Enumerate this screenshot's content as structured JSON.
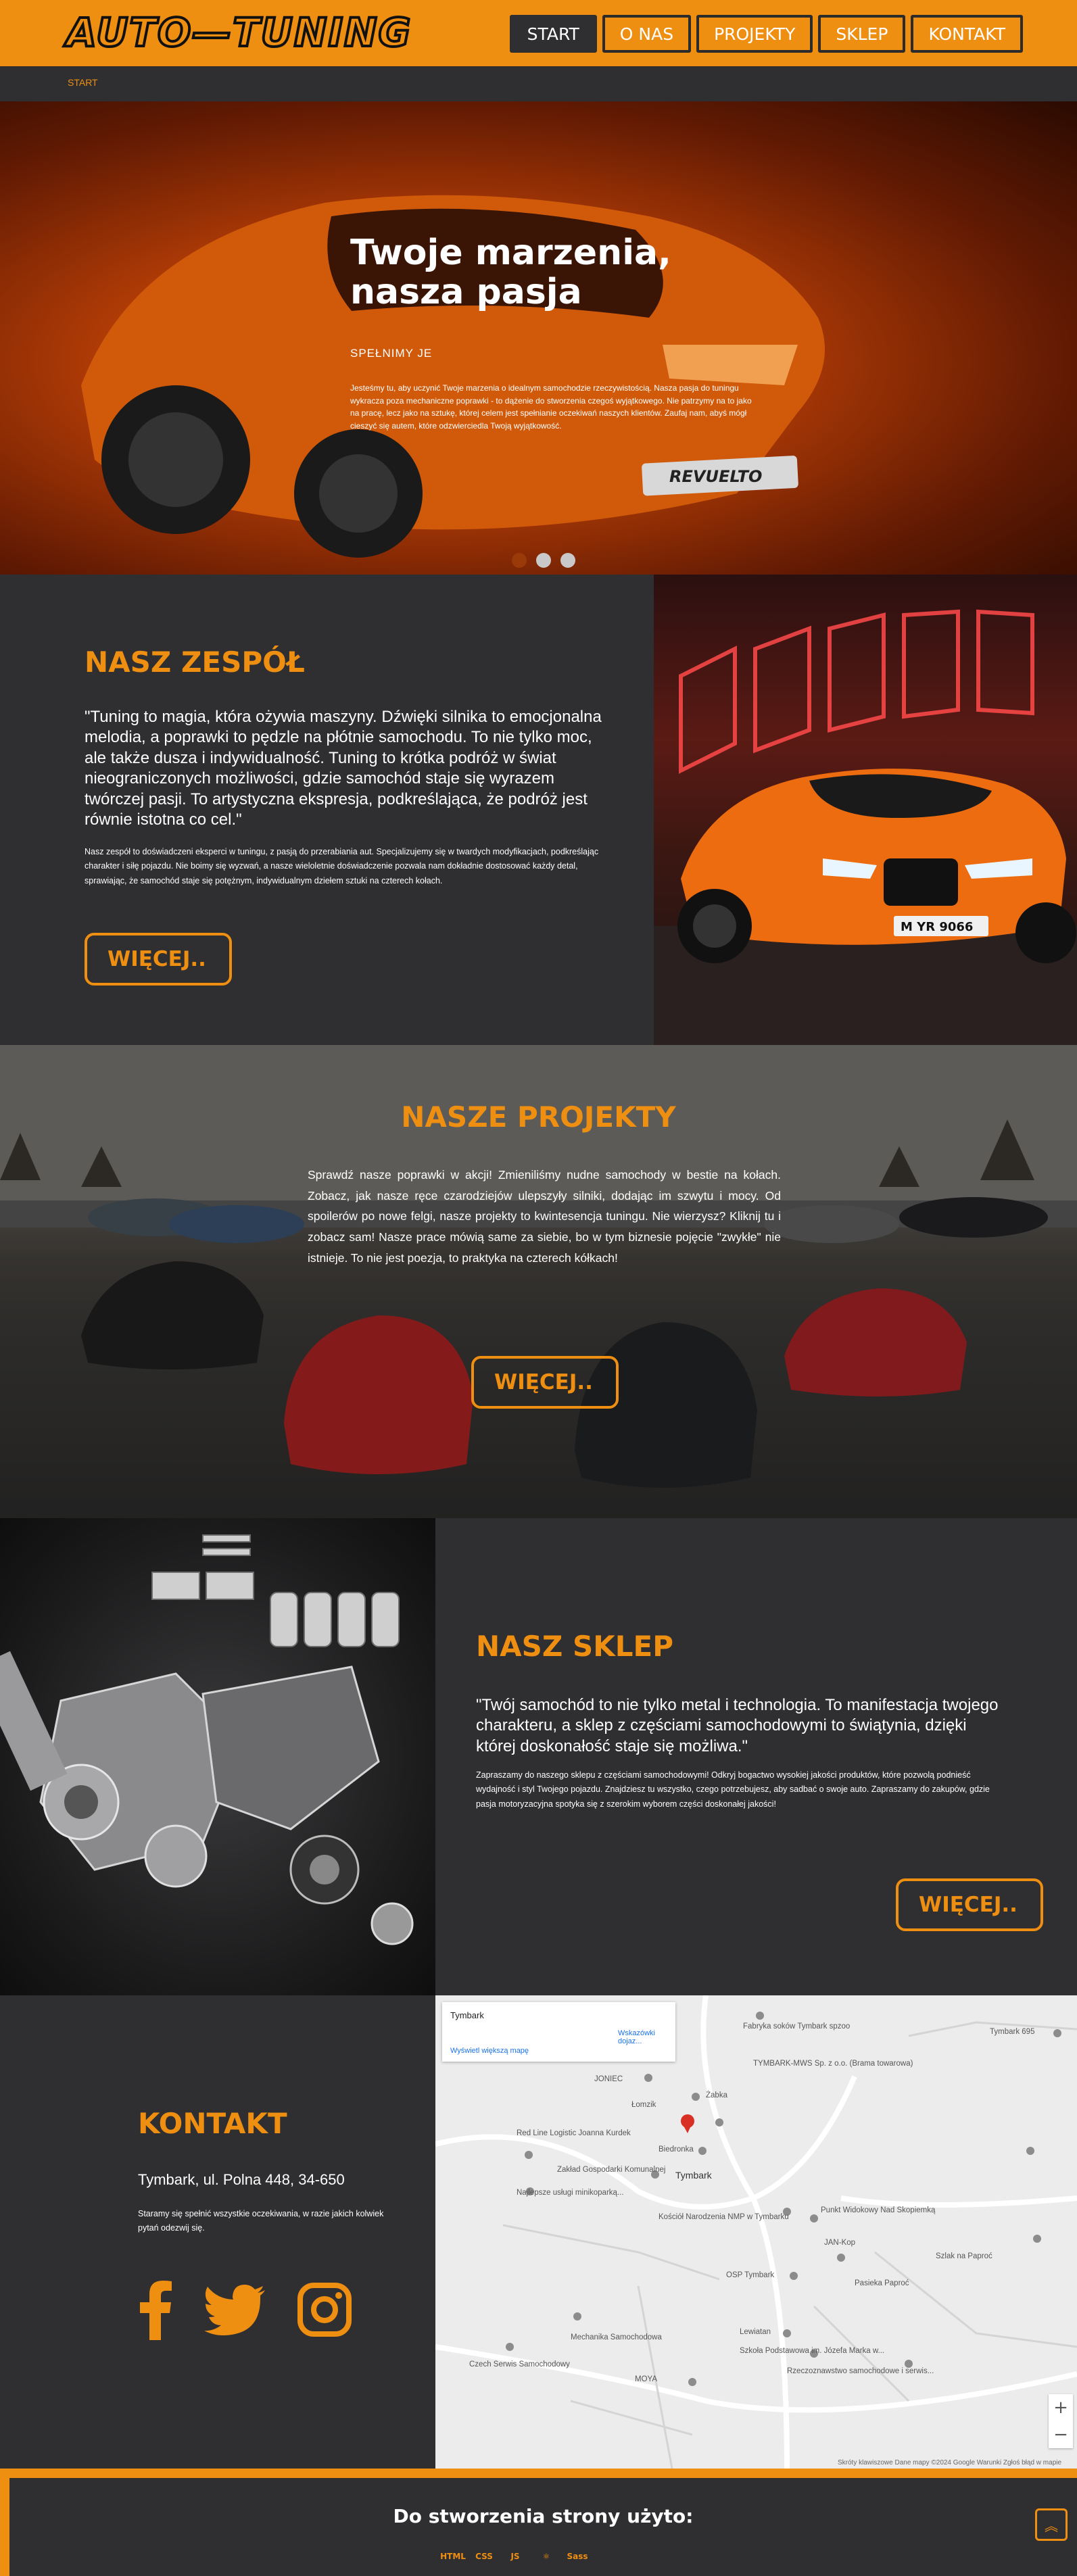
{
  "brand": {
    "logo_text": "AUTO—TUNING",
    "accent": "#ef8f12",
    "dark": "#2f2f31"
  },
  "nav": {
    "items": [
      {
        "label": "START",
        "active": true
      },
      {
        "label": "O NAS"
      },
      {
        "label": "PROJEKTY"
      },
      {
        "label": "SKLEP"
      },
      {
        "label": "KONTAKT"
      }
    ]
  },
  "breadcrumb": "START",
  "hero": {
    "title_line1": "Twoje marzenia,",
    "title_line2": "nasza pasja",
    "subtitle": "SPEŁNIMY JE",
    "text": "Jesteśmy tu, aby uczynić Twoje marzenia o idealnym samochodzie rzeczywistością. Nasza pasja do tuningu wykracza poza mechaniczne poprawki - to dążenie do stworzenia czegoś wyjątkowego. Nie patrzymy na to jako na pracę, lecz jako na sztukę, której celem jest spełnianie oczekiwań naszych klientów. Zaufaj nam, abyś mógł cieszyć się autem, które odzwierciedla Twoją wyjątkowość.",
    "plate": "REVUELTO",
    "slides": 3,
    "active_slide": 0
  },
  "team": {
    "title": "NASZ ZESPÓŁ",
    "quote": "\"Tuning to magia, która ożywia maszyny. Dźwięki silnika to emocjonalna melodia, a poprawki to pędzle na płótnie samochodu. To nie tylko moc, ale także dusza i indywidualność. Tuning to krótka podróż w świat nieograniczonych możliwości, gdzie samochód staje się wyrazem twórczej pasji. To artystyczna ekspresja, podkreślająca, że podróż jest równie istotna co cel.\"",
    "text": "Nasz zespół to doświadczeni eksperci w tuningu, z pasją do przerabiania aut. Specjalizujemy się w twardych modyfikacjach, podkreślając charakter i siłę pojazdu. Nie boimy się wyzwań, a nasze wieloletnie doświadczenie pozwala nam dokładnie dostosować każdy detal, sprawiając, że samochód staje się potężnym, indywidualnym dziełem sztuki na czterech kołach.",
    "button": "WIĘCEJ..",
    "plate": "M YR 9066"
  },
  "projects": {
    "title": "NASZE PROJEKTY",
    "text": "Sprawdź nasze poprawki w akcji! Zmieniliśmy nudne samochody w bestie na kołach. Zobacz, jak nasze ręce czarodziejów ulepszyły silniki, dodając im szwytu i mocy. Od spoilerów po nowe felgi, nasze projekty to kwintesencja tuningu. Nie wierzysz? Kliknij tu i zobacz sam! Nasze prace mówią same za siebie, bo w tym biznesie pojęcie \"zwykłe\" nie istnieje. To nie jest poezja, to praktyka na czterech kółkach!",
    "button": "WIĘCEJ.."
  },
  "shop": {
    "title": "NASZ SKLEP",
    "quote": "\"Twój samochód to nie tylko metal i technologia. To manifestacja twojego charakteru, a sklep z częściami samochodowymi to świątynia, dzięki której doskonałość staje się możliwa.\"",
    "text": "Zapraszamy do naszego sklepu z częściami samochodowymi! Odkryj bogactwo wysokiej jakości produktów, które pozwolą podnieść wydajność i styl Twojego pojazdu. Znajdziesz tu wszystko, czego potrzebujesz, aby sadbać o swoje auto. Zapraszamy do zakupów, gdzie pasja motoryzacyjna spotyka się z szerokim wyborem części doskonałej jakości!",
    "button": "WIĘCEJ.."
  },
  "contact": {
    "title": "KONTAKT",
    "address": "Tymbark, ul. Polna 448, 34-650",
    "text": "Staramy się spełnić wszystkie oczekiwania, w razie jakich kolwiek pytań odezwij się.",
    "socials": [
      "facebook-icon",
      "twitter-icon",
      "instagram-icon"
    ]
  },
  "map": {
    "place": "Tymbark",
    "directions": "Wskazówki dojaz...",
    "bigger_map": "Wyświetl większą mapę",
    "labels": [
      "Fabryka soków Tymbark spzoo",
      "Tymbark 695",
      "TYMBARK-MWS Sp. z o.o. (Brama towarowa)",
      "JONIEC",
      "Łomzik",
      "Żabka",
      "Red Line Logistic Joanna Kurdek",
      "Biedronka",
      "Zakład Gospodarki Komunalnej",
      "Tymbark",
      "Najlepsze usługi minikoparką...",
      "Punkt Widokowy Nad Skopiemką",
      "Kościół Narodzenia NMP w Tymbarku",
      "JAN-Kop",
      "Szlak na Paproć",
      "OSP Tymbark",
      "Pasieka Paproć",
      "Lewiatan",
      "Mechanika Samochodowa",
      "Szkoła Podstawowa im. Józefa Marka w...",
      "Czech Serwis Samochodowy",
      "Rzeczoznawstwo samochodowe i serwis...",
      "MOYA"
    ],
    "footer": "Skróty klawiszowe   Dane mapy ©2024 Google   Warunki   Zgłoś błąd w mapie"
  },
  "footer": {
    "title": "Do stworzenia strony użyto:",
    "tech": [
      "html5-icon",
      "css3-icon",
      "js-icon",
      "react-icon",
      "sass-icon"
    ],
    "tech_labels": [
      "HTML",
      "CSS",
      "JS",
      "⚛",
      "Sass"
    ]
  }
}
